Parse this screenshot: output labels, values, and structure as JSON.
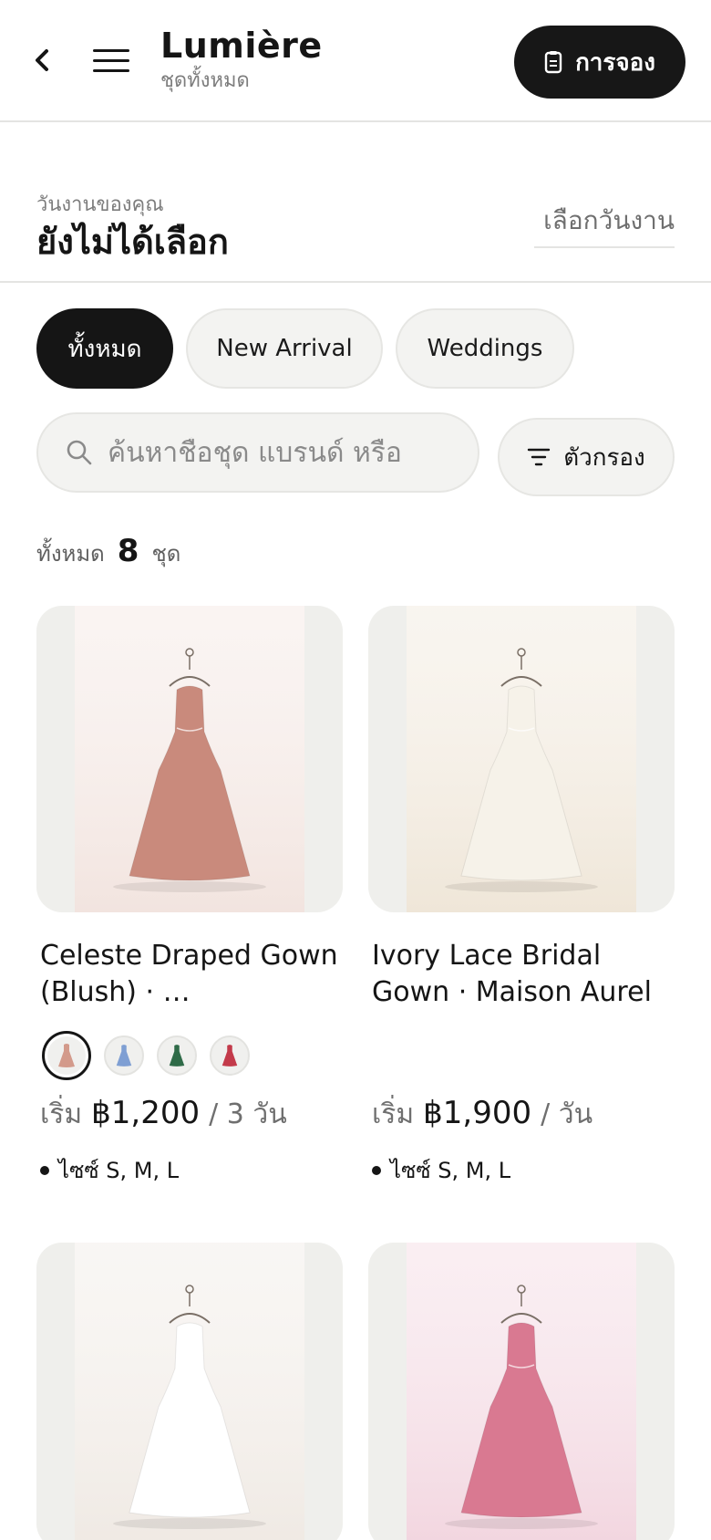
{
  "header": {
    "title": "Lumière",
    "subtitle": "ชุดทั้งหมด",
    "booking_label": "การจอง",
    "back_icon": "chevron-left-icon",
    "menu_icon": "hamburger-menu-icon",
    "booking_icon": "clipboard-icon"
  },
  "event": {
    "label": "วันงานของคุณ",
    "value": "ยังไม่ได้เลือก",
    "pick_label": "เลือกวันงาน"
  },
  "chips": [
    {
      "label": "ทั้งหมด",
      "active": true
    },
    {
      "label": "New Arrival",
      "active": false
    },
    {
      "label": "Weddings",
      "active": false
    }
  ],
  "search": {
    "placeholder": "ค้นหาชื่อชุด แบรนด์ หรือ",
    "value": "",
    "icon": "search-icon"
  },
  "filter": {
    "label": "ตัวกรอง",
    "icon": "filter-icon"
  },
  "results": {
    "label": "ทั้งหมด",
    "count": "8",
    "unit": "ชุด"
  },
  "products": [
    {
      "title": "Celeste Draped Gown (Blush) · …",
      "price_prefix": "เริ่ม",
      "price": "฿1,200",
      "price_unit": "/ 3 วัน",
      "sizes": "ไซซ์ S, M, L",
      "dress_color": "#c98a7c",
      "bg_color": "#f2e4df",
      "swatches": [
        "#d39a8b",
        "#7f9fd3",
        "#2f6b48",
        "#c33a4a"
      ]
    },
    {
      "title": "Ivory Lace Bridal Gown · Maison Aurel",
      "price_prefix": "เริ่ม",
      "price": "฿1,900",
      "price_unit": "/ วัน",
      "sizes": "ไซซ์ S, M, L",
      "dress_color": "#f6f2e9",
      "bg_color": "#efe6d8",
      "swatches": []
    },
    {
      "dress_color": "#ffffff",
      "bg_color": "#efe9e3"
    },
    {
      "dress_color": "#d97991",
      "bg_color": "#f2d5df"
    }
  ],
  "colors": {
    "primary": "#151515",
    "chip_bg": "#f3f3f1",
    "muted_text": "#7d7d7d",
    "divider": "#e4e4e2"
  }
}
